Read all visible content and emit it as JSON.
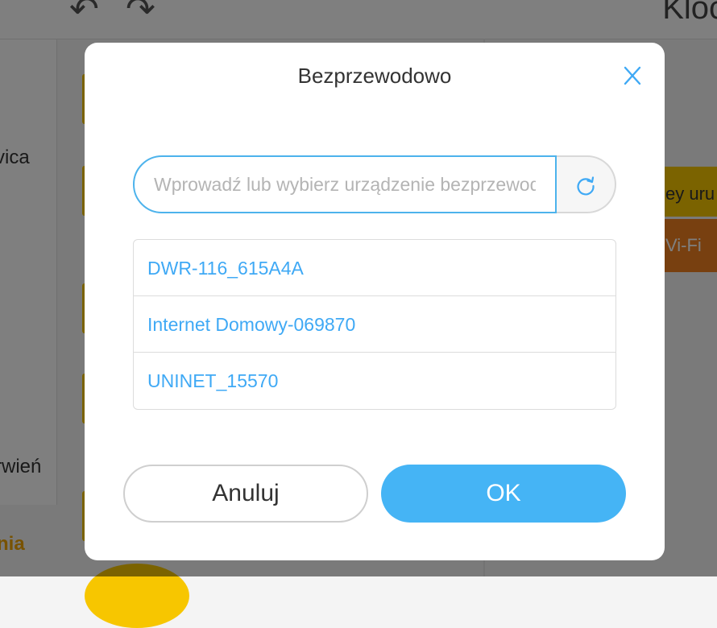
{
  "background": {
    "undo_glyph": "↶",
    "redo_glyph": "↷",
    "title_fragment": "Kloc",
    "sidebar_label_1": "vica",
    "sidebar_label_2": "rwień",
    "bottom_label": "nia",
    "yellow_button_fragment": "ey uru",
    "orange_button_fragment": "Vi-Fi"
  },
  "dialog": {
    "title": "Bezprzewodowo",
    "close_icon": "close-icon",
    "search": {
      "placeholder": "Wprowadź lub wybierz urządzenie bezprzewodowe",
      "value": ""
    },
    "refresh_icon": "refresh-icon",
    "networks": [
      {
        "name": "DWR-116_615A4A"
      },
      {
        "name": "Internet Domowy-069870"
      },
      {
        "name": "UNINET_15570"
      }
    ],
    "cancel_label": "Anuluj",
    "ok_label": "OK"
  },
  "colors": {
    "accent": "#45b4f5",
    "link": "#3fa9f5",
    "overlay": "rgba(0,0,0,0.5)"
  }
}
